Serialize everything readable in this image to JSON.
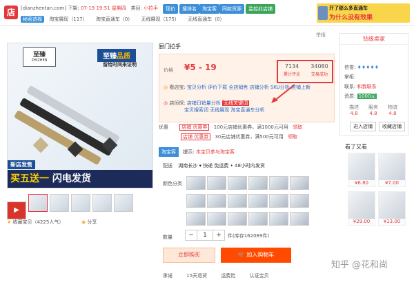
{
  "topbar": {
    "logo": "店",
    "site": "[dianzhentan.com]",
    "order_label": "下架:",
    "order_date": "07-19 19:51 星期四",
    "credit_label": "类目:",
    "credit_value": "小拉手",
    "buttons": [
      "现价",
      "搜排名",
      "淘宝客",
      "同款货源",
      "监控此店铺"
    ],
    "row2_tag": "秘密透视",
    "row2_items": [
      "淘宝展现（117）",
      "淘宝直通车（0）",
      "无线展现（175）",
      "无线直通车（0）"
    ],
    "ad_line1": "开了那么多直通车",
    "ad_line2": "为什么没有效果"
  },
  "image": {
    "brand_cn": "至臻",
    "brand_en": "ZHIZHEN",
    "quality_prefix": "至臻",
    "quality_suffix": "品质",
    "quality_sub": "留给时间来证明",
    "promo_small": "新店发售",
    "promo_main_a": "买五送一",
    "promo_main_b": "闪电发货",
    "video_icon": "▶"
  },
  "favorite": {
    "icon": "★",
    "label": "收藏宝贝（4225人气）"
  },
  "share": {
    "label": "分享"
  },
  "product": {
    "title": "厨门拉手",
    "report": "举报",
    "price_label": "价格",
    "price": "¥5 - 19",
    "stats": [
      {
        "value": "7134",
        "label": "累计评论"
      },
      {
        "value": "34080",
        "label": "交易成功"
      }
    ],
    "row1_icon": "◎",
    "row1_label": "看店宝:",
    "row1_links": "宝贝分析 评价下载 全店销售 店铺分析 SKU分析 店铺上新",
    "row2_icon": "◎",
    "row2_label": "店侦探:",
    "row2_links_a": "店铺日销量分析",
    "row2_tag": "无线关键词",
    "row2_links_b": "宝贝搜索词 无线展现 淘宝直通车分析"
  },
  "coupons": {
    "label": "优惠",
    "rows": [
      {
        "tag": "店铺 优惠券",
        "text": "100元店铺优惠券，满1000元可用",
        "get": "领取"
      },
      {
        "tag": "店铺 优惠券",
        "text": "30元店铺优惠券，满500元可用",
        "get": "领取"
      }
    ]
  },
  "tabs": {
    "tab": "淘宝客",
    "hint_label": "提示:",
    "hint": "本宝贝参与淘宝客"
  },
  "shipping": {
    "label": "配送",
    "text": "湖南长沙 ▾ 快递 免运费 • 48小时内发货"
  },
  "color": {
    "label": "颜色分类"
  },
  "quantity": {
    "label": "数量",
    "minus": "−",
    "value": "1",
    "plus": "+",
    "stock": "件(库存162089件)"
  },
  "actions": {
    "buy": "立即购买",
    "cart": "加入购物车"
  },
  "promise": {
    "label": "承诺",
    "items": [
      "15天退货",
      "运费险",
      "认证宝贝"
    ]
  },
  "seller": {
    "heading": "钻级卖家",
    "rows": [
      {
        "label": "信誉:",
        "value": "♦♦♦♦♦"
      },
      {
        "label": "掌柜:",
        "value": ""
      },
      {
        "label": "联系:",
        "value": "和我联系"
      },
      {
        "label": "资质:",
        "value": "1000元"
      }
    ],
    "scores": [
      {
        "label": "描述",
        "value": "4.8"
      },
      {
        "label": "服务",
        "value": "4.8"
      },
      {
        "label": "物流",
        "value": "4.8"
      }
    ],
    "enter": "进入店铺",
    "collect": "收藏店铺"
  },
  "recommend": {
    "title": "看了又看",
    "prices": [
      "¥6.80",
      "¥7.00",
      "¥29.00",
      "¥13.00"
    ]
  },
  "watermark": "知乎 @花和尚"
}
